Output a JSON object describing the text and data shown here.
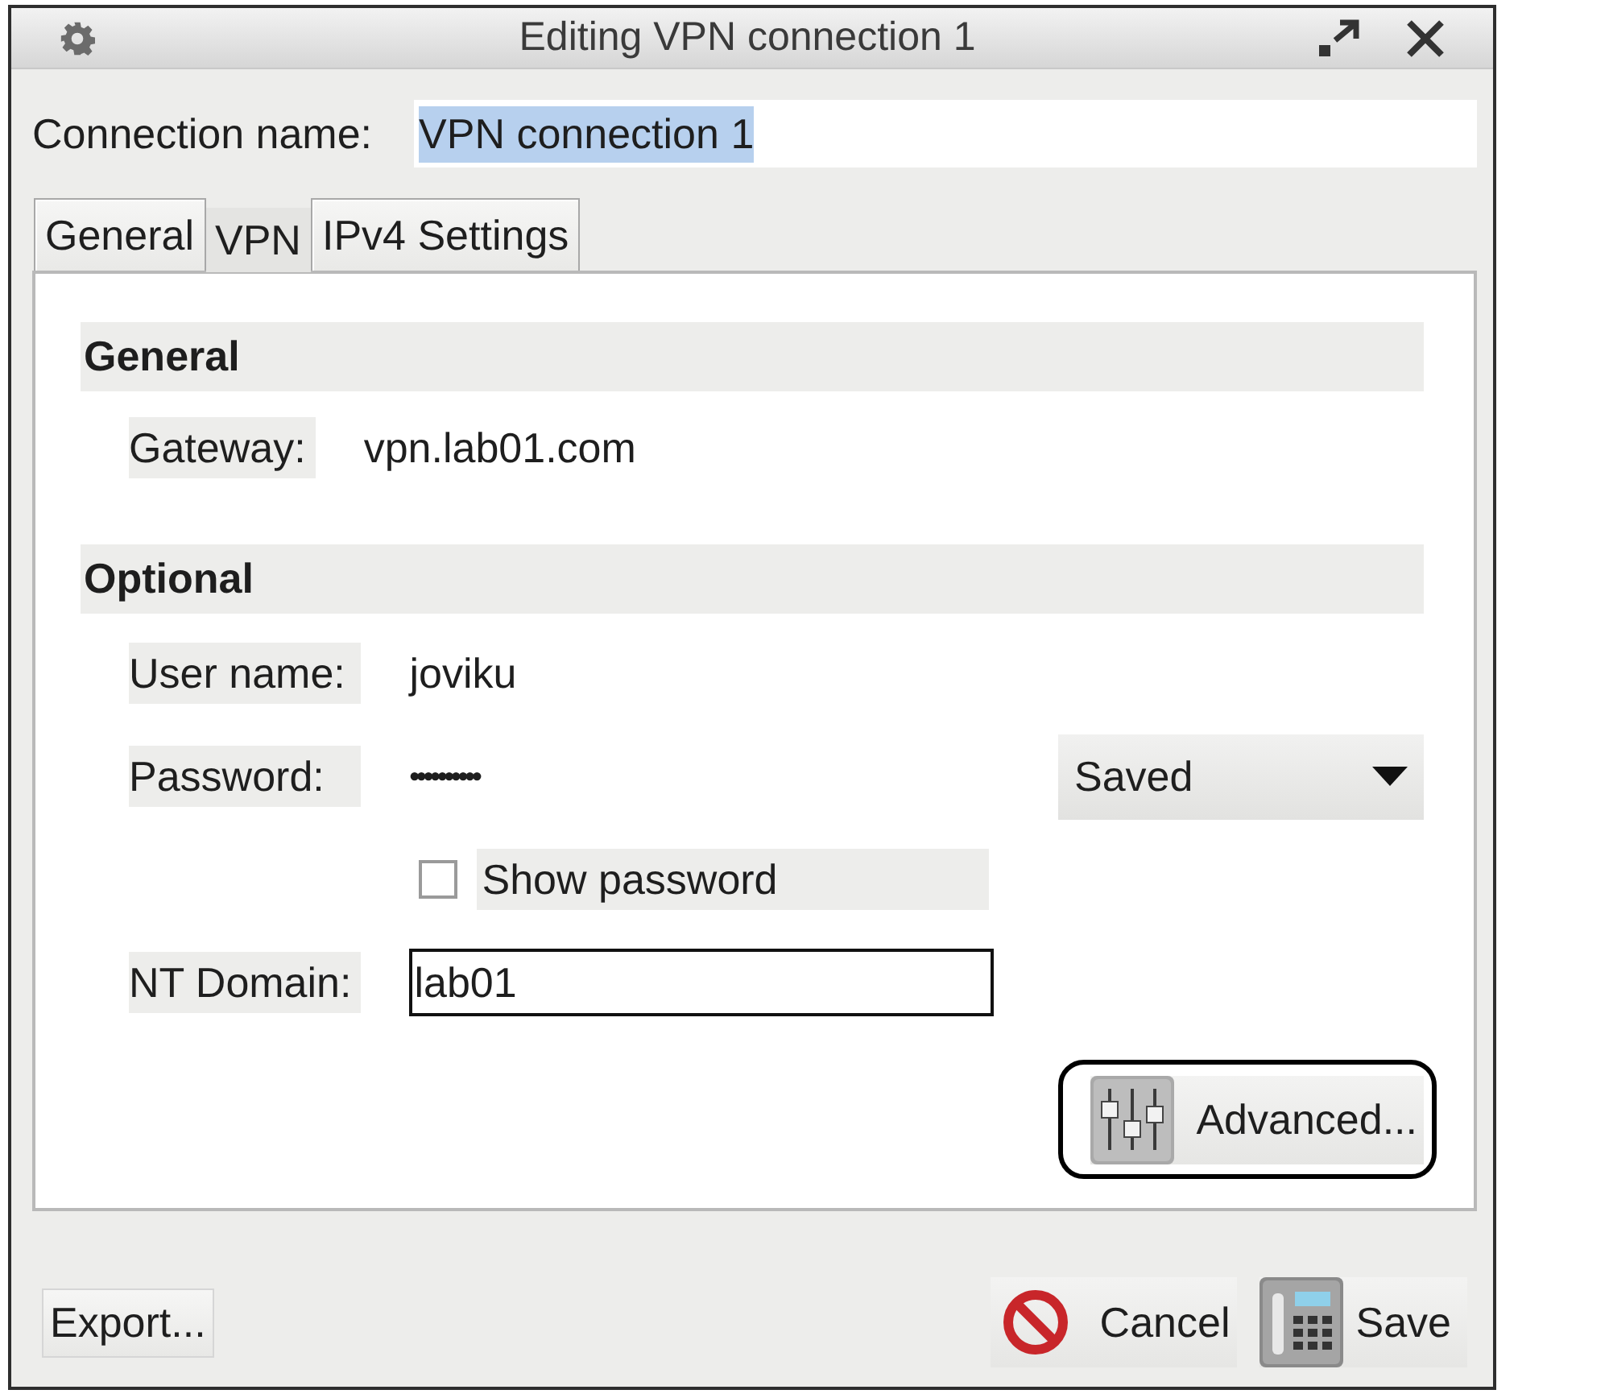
{
  "window": {
    "title": "Editing VPN connection 1"
  },
  "connection_name": {
    "label": "Connection name:",
    "value": "VPN connection 1",
    "value_selected": true
  },
  "tabs": [
    {
      "label": "General",
      "selected": false
    },
    {
      "label": "VPN",
      "selected": true
    },
    {
      "label": "IPv4 Settings",
      "selected": false
    }
  ],
  "sections": [
    {
      "title": "General",
      "fields": [
        {
          "kind": "text",
          "label": "Gateway:",
          "value": "vpn.lab01.com"
        }
      ]
    },
    {
      "title": "Optional",
      "fields": [
        {
          "kind": "text",
          "label": "User name:",
          "value": "joviku"
        },
        {
          "kind": "password",
          "label": "Password:",
          "value": "••••••••••",
          "storage": "Saved"
        },
        {
          "kind": "checkbox",
          "label": "Show password",
          "checked": false
        },
        {
          "kind": "input",
          "label": "NT Domain:",
          "value": "lab01"
        }
      ]
    }
  ],
  "advanced_button": {
    "label": "Advanced...",
    "highlighted": true
  },
  "buttons": [
    {
      "kind": "plain",
      "label": "Export..."
    },
    {
      "kind": "cancel",
      "label": "Cancel"
    },
    {
      "kind": "save",
      "label": "Save"
    }
  ]
}
